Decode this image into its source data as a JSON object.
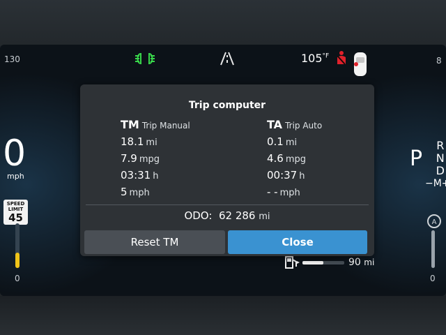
{
  "status_bar": {
    "left_gauge_max": "130",
    "right_gauge_max": "8",
    "outside_temp_value": "105",
    "outside_temp_unit": "°F",
    "headlight_icon_color": "#38d64a",
    "seatbelt_icon_color": "#e0212b"
  },
  "speedometer": {
    "speed": "0",
    "unit": "mph",
    "gauge_min": "0",
    "speed_limit_label_1": "SPEED",
    "speed_limit_label_2": "LIMIT",
    "speed_limit_value": "45"
  },
  "gear": {
    "current": "P",
    "options": [
      "R",
      "N",
      "D"
    ],
    "manual": "−M+"
  },
  "right_gauge_min": "0",
  "fuel": {
    "range_value": "90",
    "range_unit": "mi",
    "level_fraction": 0.5
  },
  "trip_computer": {
    "title": "Trip computer",
    "tm": {
      "abbr": "TM",
      "name": "Trip Manual",
      "rows": [
        {
          "value": "18.1",
          "unit": "mi"
        },
        {
          "value": "7.9",
          "unit": "mpg"
        },
        {
          "value": "03:31",
          "unit": "h"
        },
        {
          "value": "5",
          "unit": "mph"
        }
      ]
    },
    "ta": {
      "abbr": "TA",
      "name": "Trip Auto",
      "rows": [
        {
          "value": "0.1",
          "unit": "mi"
        },
        {
          "value": "4.6",
          "unit": "mpg"
        },
        {
          "value": "00:37",
          "unit": "h"
        },
        {
          "value": "- -",
          "unit": "mph"
        }
      ]
    },
    "odo_label": "ODO:",
    "odo_value": "62 286",
    "odo_unit": "mi",
    "reset_label": "Reset TM",
    "close_label": "Close",
    "close_color": "#3a92d1"
  }
}
